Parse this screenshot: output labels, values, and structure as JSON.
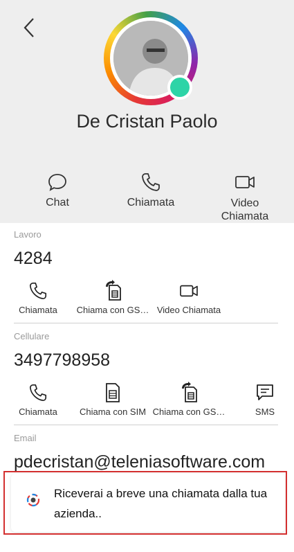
{
  "contact": {
    "name": "De Cristan Paolo"
  },
  "quick_actions": [
    {
      "label": "Chat",
      "icon": "chat-bubble-icon"
    },
    {
      "label": "Chiamata",
      "icon": "phone-icon"
    },
    {
      "label": "Video\nChiamata",
      "icon": "video-camera-icon"
    }
  ],
  "work": {
    "label": "Lavoro",
    "value": "4284",
    "actions": [
      "Chiamata",
      "Chiama con GS…",
      "Video Chiamata"
    ]
  },
  "mobile": {
    "label": "Cellulare",
    "value": "3497798958",
    "actions": [
      "Chiamata",
      "Chiama con SIM",
      "Chiama con GS…",
      "SMS"
    ]
  },
  "email": {
    "label": "Email",
    "value": "pdecristan@teleniasoftware.com"
  },
  "toast": {
    "message": "Riceverai a breve una chiamata dalla tua azienda.."
  },
  "colors": {
    "status_online": "#2dd4a7",
    "highlight_border": "#d32f2f"
  }
}
